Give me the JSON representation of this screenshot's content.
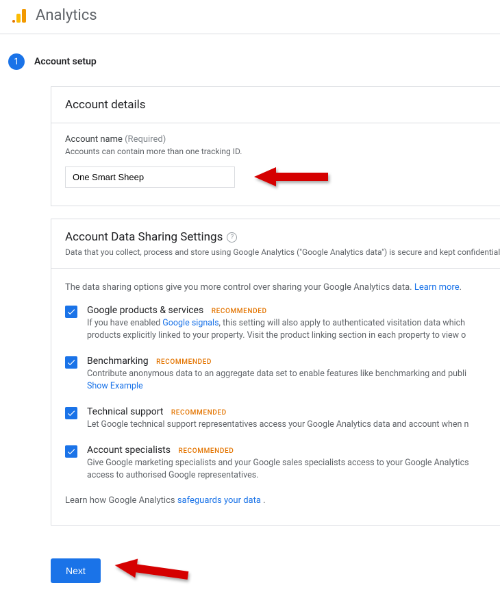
{
  "app_title": "Analytics",
  "step": {
    "number": "1",
    "title": "Account setup"
  },
  "account_details": {
    "panel_title": "Account details",
    "name_label": "Account name",
    "required": "(Required)",
    "name_hint": "Accounts can contain more than one tracking ID.",
    "name_value": "One Smart Sheep"
  },
  "sharing": {
    "title": "Account Data Sharing Settings",
    "subtitle": "Data that you collect, process and store using Google Analytics (\"Google Analytics data\") is secure and kept confidential. Th",
    "intro_prefix": "The data sharing options give you more control over sharing your Google Analytics data. ",
    "learn_more": "Learn more",
    "period": ".",
    "recommended": "RECOMMENDED",
    "options": [
      {
        "title": "Google products & services",
        "desc_before": "If you have enabled ",
        "desc_link": "Google signals",
        "desc_after": ", this setting will also apply to authenticated visitation data which",
        "desc_line2": "products explicitly linked to your property. Visit the product linking section in each property to view o"
      },
      {
        "title": "Benchmarking",
        "desc_before": "Contribute anonymous data to an aggregate data set to enable features like benchmarking and publi",
        "show_example": "Show Example"
      },
      {
        "title": "Technical support",
        "desc_before": "Let Google technical support representatives access your Google Analytics data and account when n"
      },
      {
        "title": "Account specialists",
        "desc_before": "Give Google marketing specialists and your Google sales specialists access to your Google Analytics",
        "desc_line2": "access to authorised Google representatives."
      }
    ],
    "footer_prefix": "Learn how Google Analytics ",
    "footer_link": "safeguards your data",
    "footer_period": " ."
  },
  "actions": {
    "next": "Next"
  }
}
